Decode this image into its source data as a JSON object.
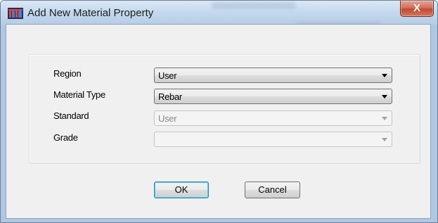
{
  "window": {
    "title": "Add New Material Property",
    "close_label": "X"
  },
  "form": {
    "region": {
      "label": "Region",
      "value": "User",
      "enabled": true
    },
    "material_type": {
      "label": "Material Type",
      "value": "Rebar",
      "enabled": true
    },
    "standard": {
      "label": "Standard",
      "value": "User",
      "enabled": false
    },
    "grade": {
      "label": "Grade",
      "value": "",
      "enabled": false
    }
  },
  "buttons": {
    "ok_label": "OK",
    "cancel_label": "Cancel"
  },
  "icons": {
    "app": "app-icon",
    "dropdown": "chevron-down-icon"
  },
  "colors": {
    "close_button": "#c24a33",
    "title_bar": "#c5d9ee",
    "client_bg": "#f0f0f0"
  }
}
